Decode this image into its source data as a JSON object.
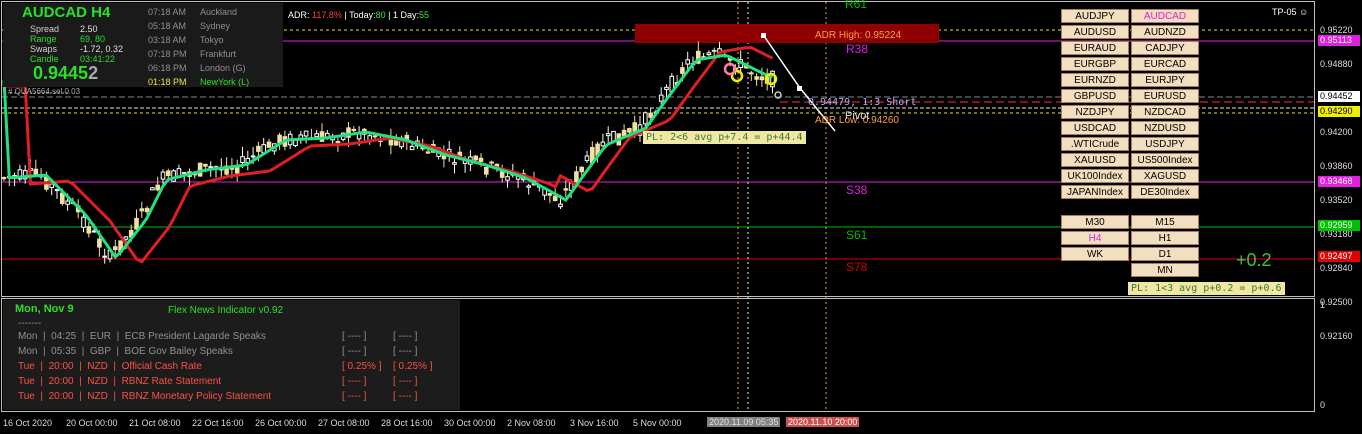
{
  "info": {
    "symbol": "AUDCAD H4",
    "rows": [
      {
        "k": "Spread",
        "v": "2.50"
      },
      {
        "k": "Range",
        "v": "69, 80"
      },
      {
        "k": "Swaps",
        "v": "-1.72, 0.32"
      },
      {
        "k": "Candle",
        "v": "03:41:22"
      }
    ],
    "price_main": "0.9445",
    "price_last": "2",
    "sessions": [
      {
        "time": "07:18 AM",
        "city": "Auckland"
      },
      {
        "time": "05:18 AM",
        "city": "Sydney"
      },
      {
        "time": "03:18 AM",
        "city": "Tokyo"
      },
      {
        "time": "07:18 PM",
        "city": "Frankfurt"
      },
      {
        "time": "06:18 PM",
        "city": "London  (G)"
      },
      {
        "time": "01:18 PM",
        "city": "NewYork  (L)"
      }
    ]
  },
  "adr": {
    "label": "ADR:",
    "pct": "117.8%",
    "sep1": "|",
    "today_label": "Today:",
    "today": "80",
    "sep2": "|",
    "day_label": "1 Day:",
    "day": "55"
  },
  "corner_label": "TP-05",
  "small_left_label": "# QUA5664 sel 0.03",
  "symbols": [
    [
      "AUDJPY",
      "AUDCAD"
    ],
    [
      "AUDUSD",
      "AUDNZD"
    ],
    [
      "EURAUD",
      "CADJPY"
    ],
    [
      "EURGBP",
      "EURCAD"
    ],
    [
      "EURNZD",
      "EURJPY"
    ],
    [
      "GBPUSD",
      "EURUSD"
    ],
    [
      "NZDJPY",
      "NZDCAD"
    ],
    [
      "USDCAD",
      "NZDUSD"
    ],
    [
      ".WTICrude",
      "USDJPY"
    ],
    [
      "XAUUSD",
      "US500Index"
    ],
    [
      "UK100Index",
      "XAGUSD"
    ],
    [
      "JAPANIndex",
      "DE30Index"
    ]
  ],
  "timeframes": [
    [
      "M30",
      "M15"
    ],
    [
      "H4",
      "H1"
    ],
    [
      "WK",
      "D1"
    ],
    [
      "",
      "MN"
    ]
  ],
  "price_scale": [
    "0.95220",
    "0.94880",
    "0.94540",
    "0.94200",
    "0.93860",
    "0.93520",
    "0.93180",
    "0.92840",
    "0.92500",
    "0.92160"
  ],
  "price_tags": [
    {
      "v": "0.95113",
      "bg": "#e020e0",
      "fg": "#ffffff"
    },
    {
      "v": "0.94452",
      "bg": "#ffffff",
      "fg": "#000000"
    },
    {
      "v": "0.94290",
      "bg": "#f0f000",
      "fg": "#000000"
    },
    {
      "v": "0.93468",
      "bg": "#e020e0",
      "fg": "#ffffff"
    },
    {
      "v": "0.92959",
      "bg": "#00c000",
      "fg": "#ffffff"
    },
    {
      "v": "0.92497",
      "bg": "#e00000",
      "fg": "#ffffff"
    }
  ],
  "levels": {
    "r61": "R61",
    "r38": "R38",
    "s38": "S38",
    "s61": "S61",
    "s78": "S78"
  },
  "adr_high": "ADR High: 0.95224",
  "adr_low": "ADR Low: 0.94260",
  "pivot": "Pivot",
  "short_text": "0.94479, 1:3 Short",
  "pl_mid": "PL: 2<6 avg p+7.4 = p+44.4",
  "pl_right": "PL: 1<3 avg p+0.2 = p+0.6",
  "big_pl": "+0.2",
  "indicator_scale": {
    "top": "1",
    "bottom": "0"
  },
  "news": {
    "date": "Mon, Nov 9",
    "title": "Flex News Indicator v0.92",
    "dashes": "-------",
    "rows": [
      {
        "text": "Mon  |  04:25  |  EUR  |  ECB President Lagarde Speaks",
        "a": "[ ---- ]",
        "b": "[ ---- ]",
        "red": false
      },
      {
        "text": "Mon  |  05:35  |  GBP  |  BOE Gov Bailey Speaks",
        "a": "[ ---- ]",
        "b": "[ ---- ]",
        "red": false
      },
      {
        "text": "Tue  |  20:00  |  NZD  |  Official Cash Rate",
        "a": "[ 0.25% ]",
        "b": "[ 0.25% ]",
        "red": true
      },
      {
        "text": "Tue  |  20:00  |  NZD  |  RBNZ Rate Statement",
        "a": "[ ---- ]",
        "b": "[ ---- ]",
        "red": true
      },
      {
        "text": "Tue  |  20:00  |  NZD  |  RBNZ Monetary Policy Statement",
        "a": "[ ---- ]",
        "b": "[ ---- ]",
        "red": true
      }
    ]
  },
  "time_axis": [
    "16 Oct 2020",
    "20 Oct 00:00",
    "21 Oct 08:00",
    "22 Oct 16:00",
    "26 Oct 00:00",
    "27 Oct 08:00",
    "28 Oct 16:00",
    "30 Oct 00:00",
    "2 Nov 08:00",
    "3 Nov 16:00",
    "5 Nov 00:00"
  ],
  "time_tag_1": "2020.11.09 05:35",
  "time_tag_2": "2020.11.10 20:00",
  "colors": {
    "bull": "#ffffff",
    "bear": "#f3dfa0",
    "ema_fast": "#20e080",
    "ema_slow": "#e02020",
    "magenta": "#e020e0",
    "green": "#00c000",
    "red": "#e00000",
    "orange": "#ffa040"
  }
}
